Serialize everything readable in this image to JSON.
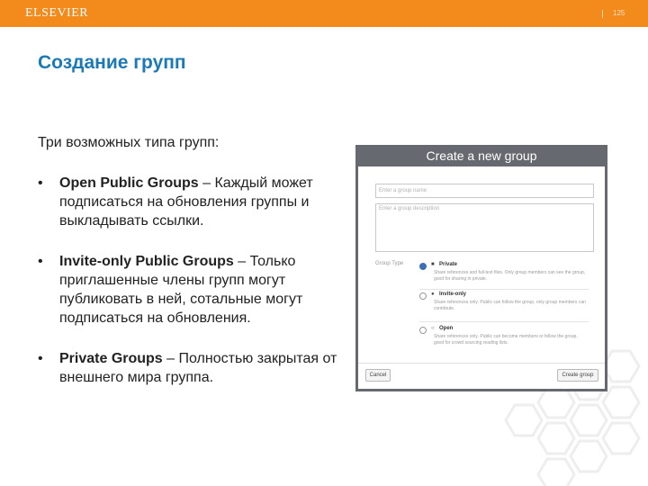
{
  "header": {
    "logo": "ELSEVIER",
    "page_number": "125"
  },
  "slide": {
    "title": "Создание групп",
    "intro": "Три возможных типа групп:",
    "bullets": [
      {
        "bold": "Open Public Groups",
        "rest": " – Каждый может подписаться на обновления группы и выкладывать ссылки."
      },
      {
        "bold": "Invite-only Public Groups",
        "rest": " – Только приглашенные члены групп могут публиковать в ней, сотальные могут подписаться на обновления."
      },
      {
        "bold": "Private Groups",
        "rest": " – Полностью закрытая от внешнего мира группа."
      }
    ]
  },
  "dialog": {
    "title": "Create a new group",
    "name_placeholder": "Enter a group name",
    "desc_placeholder": "Enter a group description",
    "group_type_label": "Group Type",
    "options": [
      {
        "label": "Private",
        "desc": "Share references and full-text files. Only group members can see the group, good for sharing in private.",
        "checked": true
      },
      {
        "label": "Invite-only",
        "desc": "Share references only. Public can follow the group, only group members can contribute.",
        "checked": false
      },
      {
        "label": "Open",
        "desc": "Share references only. Public can become members or follow the group, good for crowd sourcing reading lists.",
        "checked": false
      }
    ],
    "cancel_label": "Cancel",
    "create_label": "Create group"
  },
  "colors": {
    "topbar": "#f28a1c",
    "title": "#1b7ab5",
    "dialog_frame": "#666a70"
  }
}
